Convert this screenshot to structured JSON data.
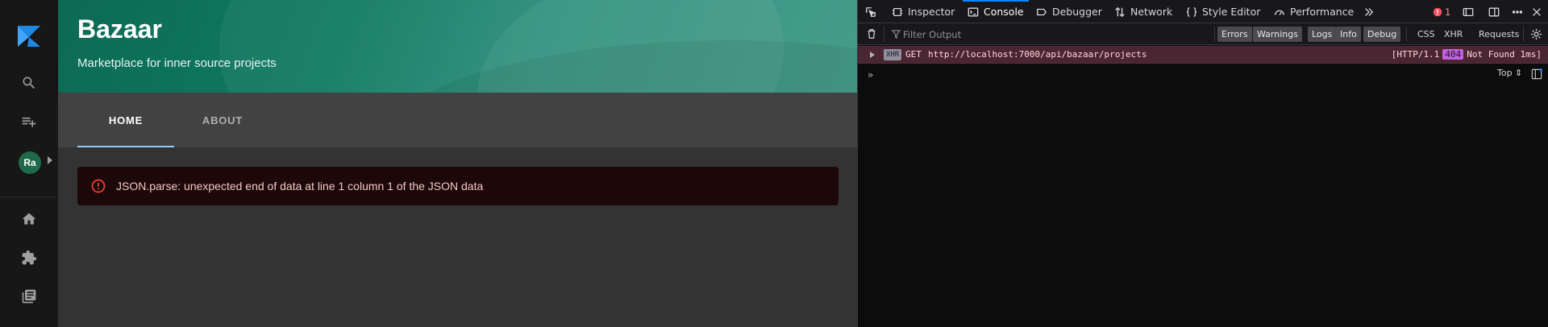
{
  "sidebar": {
    "avatar_initials": "Ra",
    "icons": [
      "backstage-logo-icon",
      "search-icon",
      "playlist-add-icon",
      "home-icon",
      "extension-icon",
      "library-books-icon"
    ]
  },
  "header": {
    "title": "Bazaar",
    "subtitle": "Marketplace for inner source projects"
  },
  "tabs": [
    {
      "label": "HOME",
      "active": true
    },
    {
      "label": "ABOUT",
      "active": false
    }
  ],
  "alert": {
    "message": "JSON.parse: unexpected end of data at line 1 column 1 of the JSON data",
    "color": "#f44336"
  },
  "devtools": {
    "tabs": {
      "inspector": "Inspector",
      "console": "Console",
      "debugger": "Debugger",
      "network": "Network",
      "style_editor": "Style Editor",
      "performance": "Performance"
    },
    "error_count": "1",
    "filter_placeholder": "Filter Output",
    "filters": {
      "errors": "Errors",
      "warnings": "Warnings",
      "logs": "Logs",
      "info": "Info",
      "debug": "Debug",
      "css": "CSS",
      "xhr": "XHR",
      "requests": "Requests"
    },
    "log": {
      "badge": "XHR",
      "method": "GET",
      "url": "http://localhost:7000/api/bazaar/projects",
      "protocol": "[HTTP/1.1",
      "status_code": "404",
      "status_text": "Not Found 1ms]"
    },
    "prompt": "»",
    "context_selector": "Top ⇕"
  }
}
